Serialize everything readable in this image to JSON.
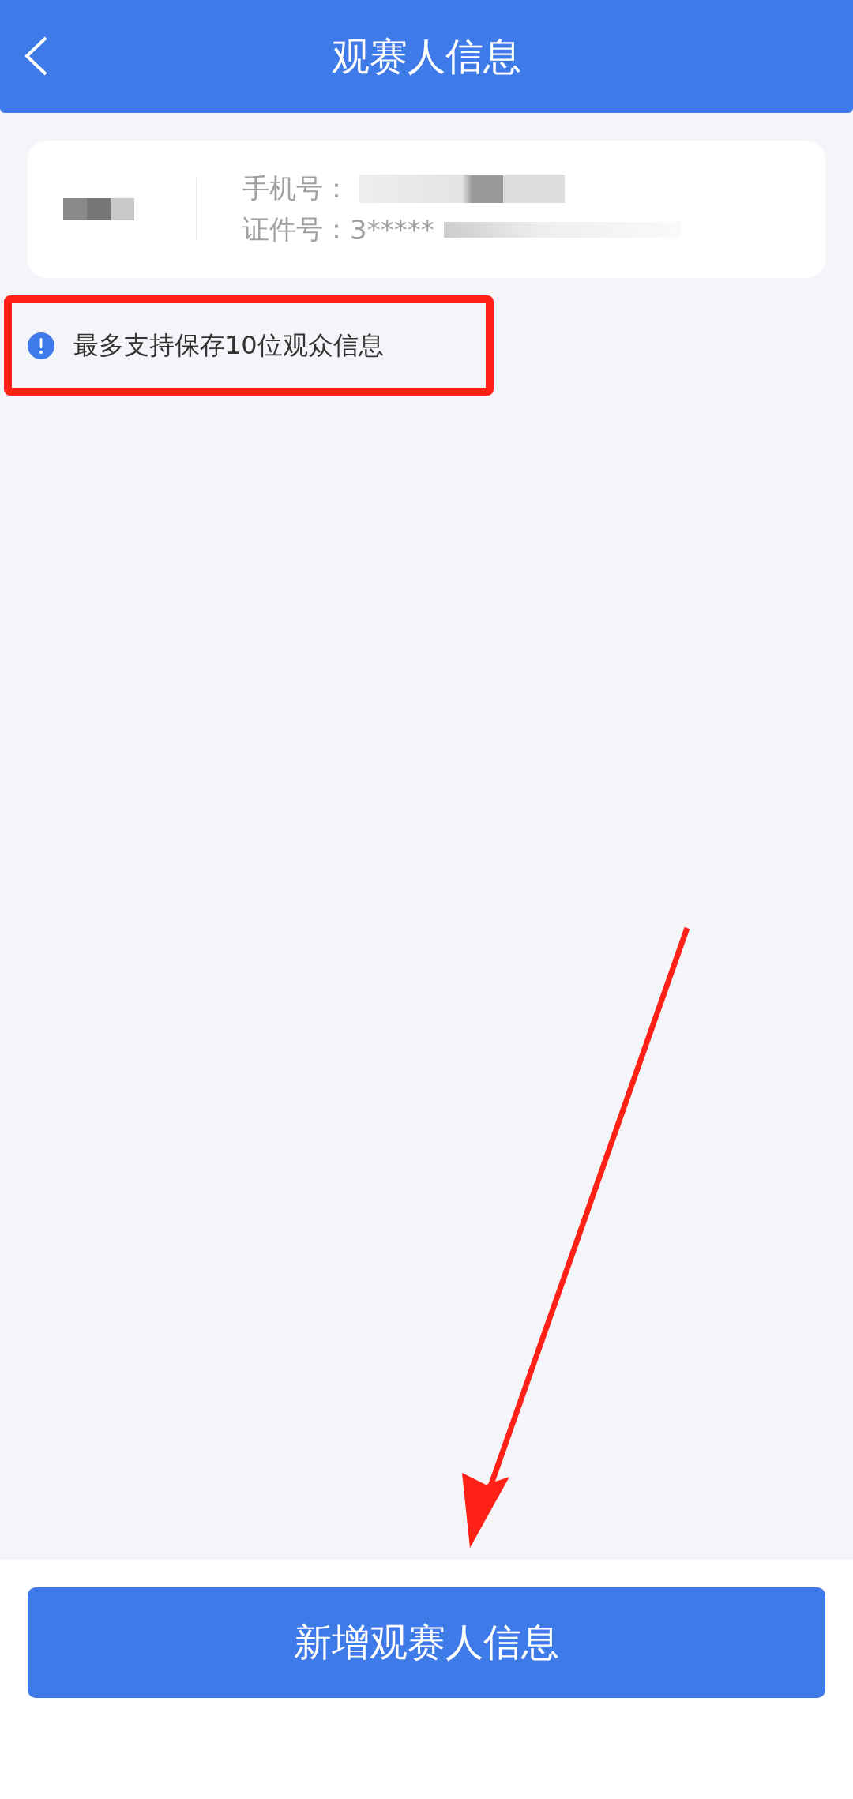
{
  "header": {
    "title": "观赛人信息"
  },
  "spectators": [
    {
      "phone_label": "手机号：",
      "id_label": "证件号：",
      "id_value": "3*****"
    }
  ],
  "notice": {
    "text": "最多支持保存10位观众信息",
    "highlighted": true
  },
  "add_button": {
    "label": "新增观赛人信息"
  }
}
